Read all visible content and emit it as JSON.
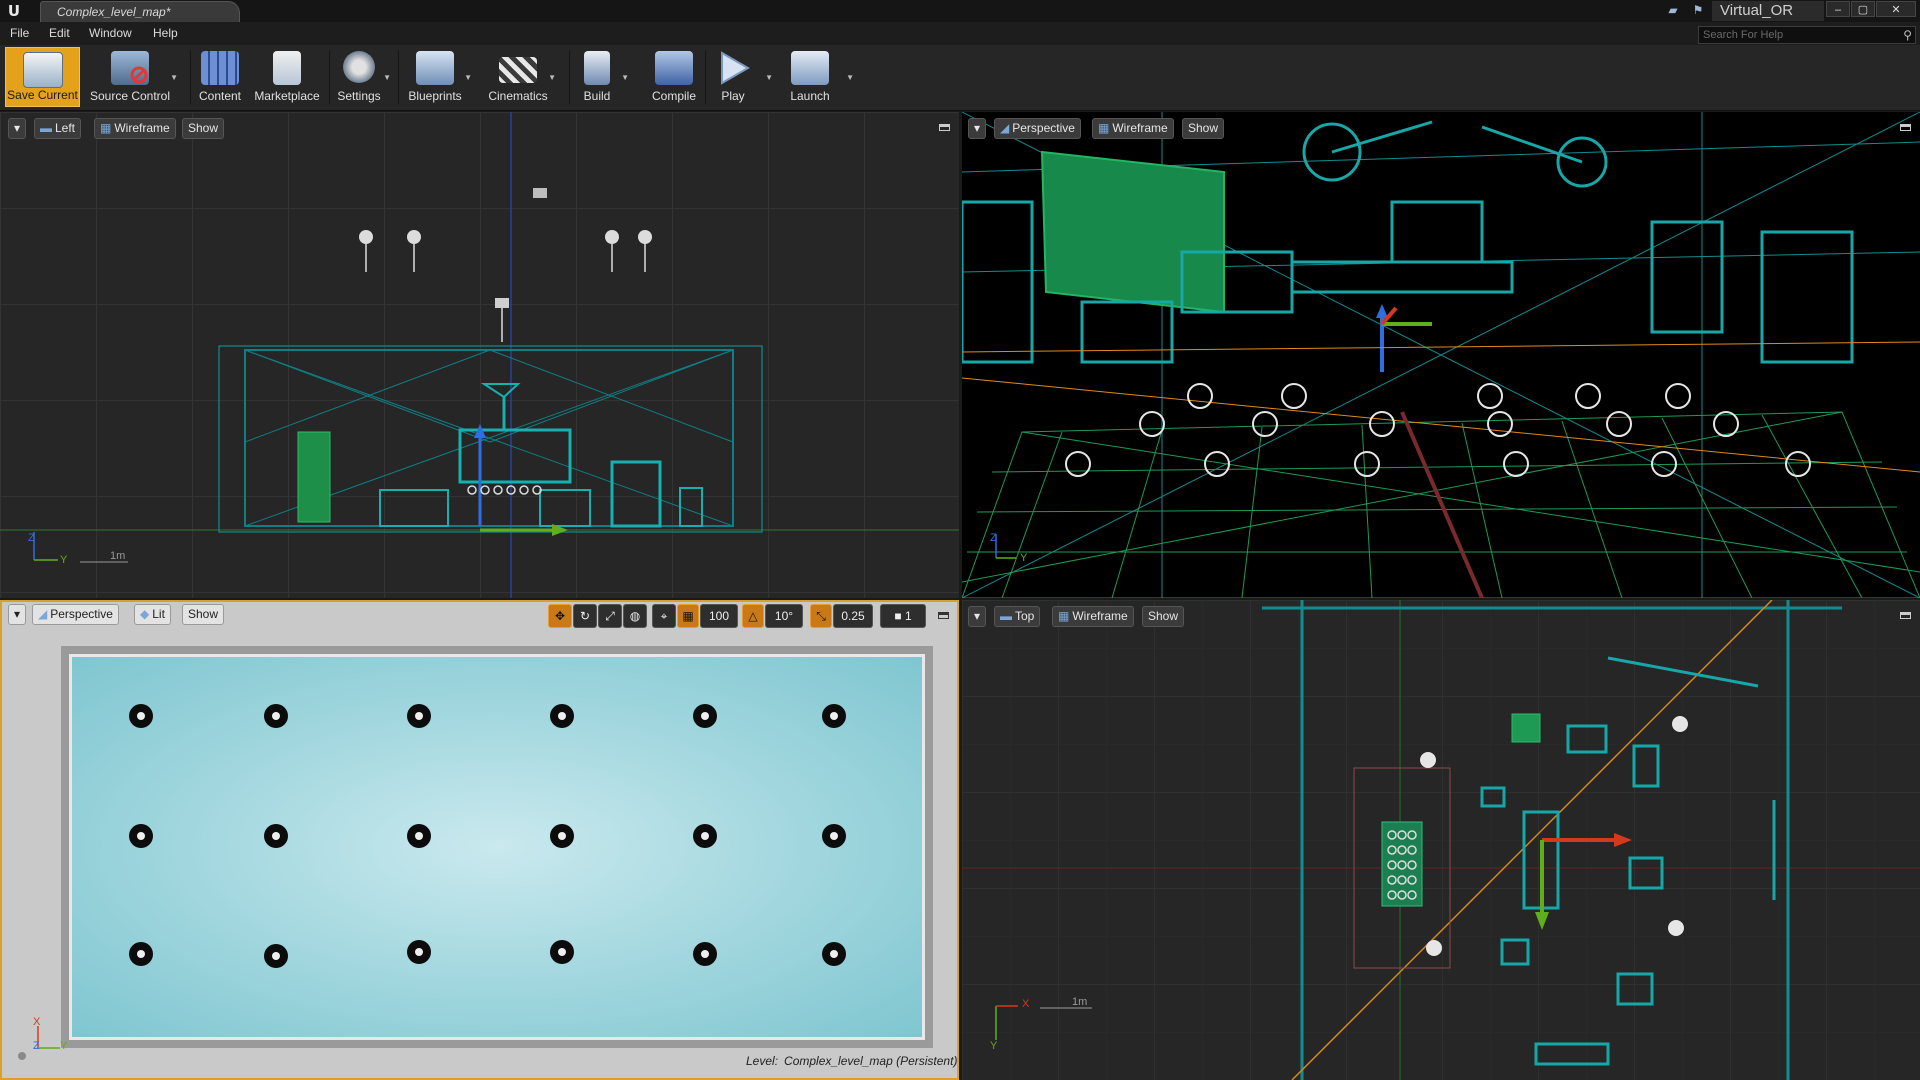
{
  "app": {
    "document_tab": "Complex_level_map*",
    "project_name": "Virtual_OR",
    "search_help_placeholder": "Search For Help",
    "window_min": "–",
    "window_max": "▢",
    "window_close": "✕"
  },
  "menu": [
    "File",
    "Edit",
    "Window",
    "Help"
  ],
  "toolbar": {
    "save_current": "Save Current",
    "source_control": "Source Control",
    "content": "Content",
    "marketplace": "Marketplace",
    "settings": "Settings",
    "blueprints": "Blueprints",
    "cinematics": "Cinematics",
    "build": "Build",
    "compile": "Compile",
    "play": "Play",
    "launch": "Launch"
  },
  "viewports": {
    "left": {
      "view": "Left",
      "mode": "Wireframe",
      "show": "Show",
      "scale": "1m",
      "axis_z": "Z",
      "axis_y": "Y"
    },
    "perspective_wire": {
      "view": "Perspective",
      "mode": "Wireframe",
      "show": "Show",
      "axis_z": "Z",
      "axis_y": "Y"
    },
    "perspective_lit": {
      "view": "Perspective",
      "mode": "Lit",
      "show": "Show",
      "grid_snap": "100",
      "rotation_snap": "10°",
      "scale_snap": "0.25",
      "camera_speed": "1",
      "axis_x": "X",
      "axis_y": "Y",
      "axis_z": "Z",
      "level_prefix": "Level:",
      "level_name": "Complex_level_map (Persistent)"
    },
    "top": {
      "view": "Top",
      "mode": "Wireframe",
      "show": "Show",
      "scale": "1m",
      "axis_x": "X",
      "axis_y": "Y"
    }
  },
  "colors": {
    "accent": "#e3a21a",
    "wire_teal": "#14a5a5",
    "wire_green": "#1f9a55",
    "axis_red": "#d23a1e",
    "axis_green": "#5fae1c",
    "axis_blue": "#2d6fe0"
  }
}
